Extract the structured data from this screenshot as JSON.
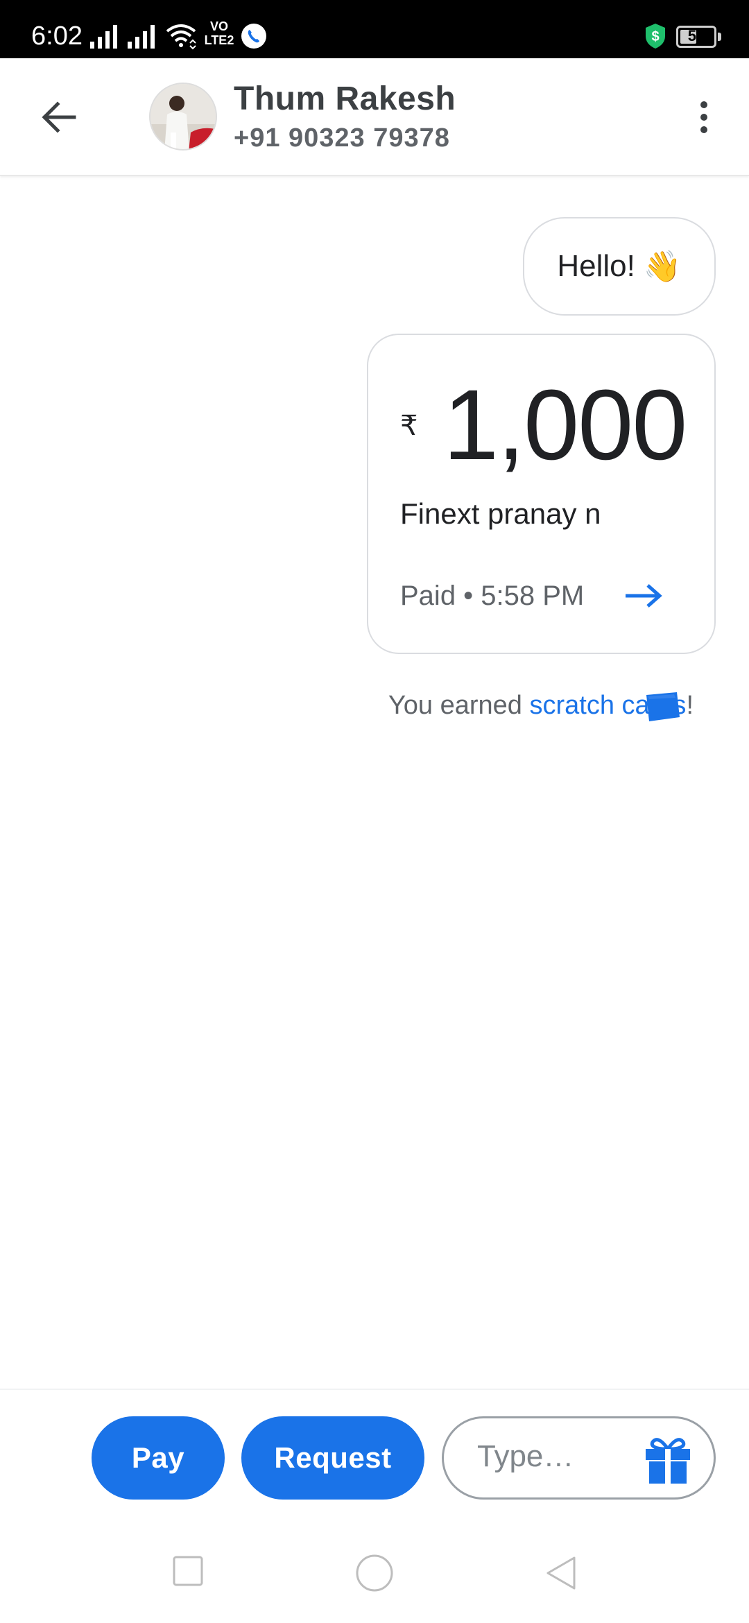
{
  "status_bar": {
    "time": "6:02",
    "network_label_top": "VO",
    "network_label_bottom": "LTE2",
    "battery_level": "51",
    "battery_fraction": 0.51
  },
  "header": {
    "back_icon": "arrow-left-icon",
    "contact_name": "Thum Rakesh",
    "contact_phone": "+91 90323 79378",
    "menu_icon": "more-vert-icon"
  },
  "chat": {
    "greeting_text": "Hello!",
    "greeting_emoji": "👋",
    "payment": {
      "currency_symbol": "₹",
      "amount": "1,000",
      "note": "Finext pranay n",
      "status": "Paid • 5:58 PM"
    },
    "reward": {
      "prefix": "You earned ",
      "link_text": "scratch cards",
      "suffix": "!"
    }
  },
  "composer": {
    "pay_label": "Pay",
    "request_label": "Request",
    "input_placeholder": "Type…",
    "gift_icon": "gift-icon"
  },
  "colors": {
    "accent": "#1a73e8",
    "text_primary": "#202124",
    "text_secondary": "#5f6368",
    "border": "#dadce0",
    "status_bar_bg": "#000000"
  }
}
